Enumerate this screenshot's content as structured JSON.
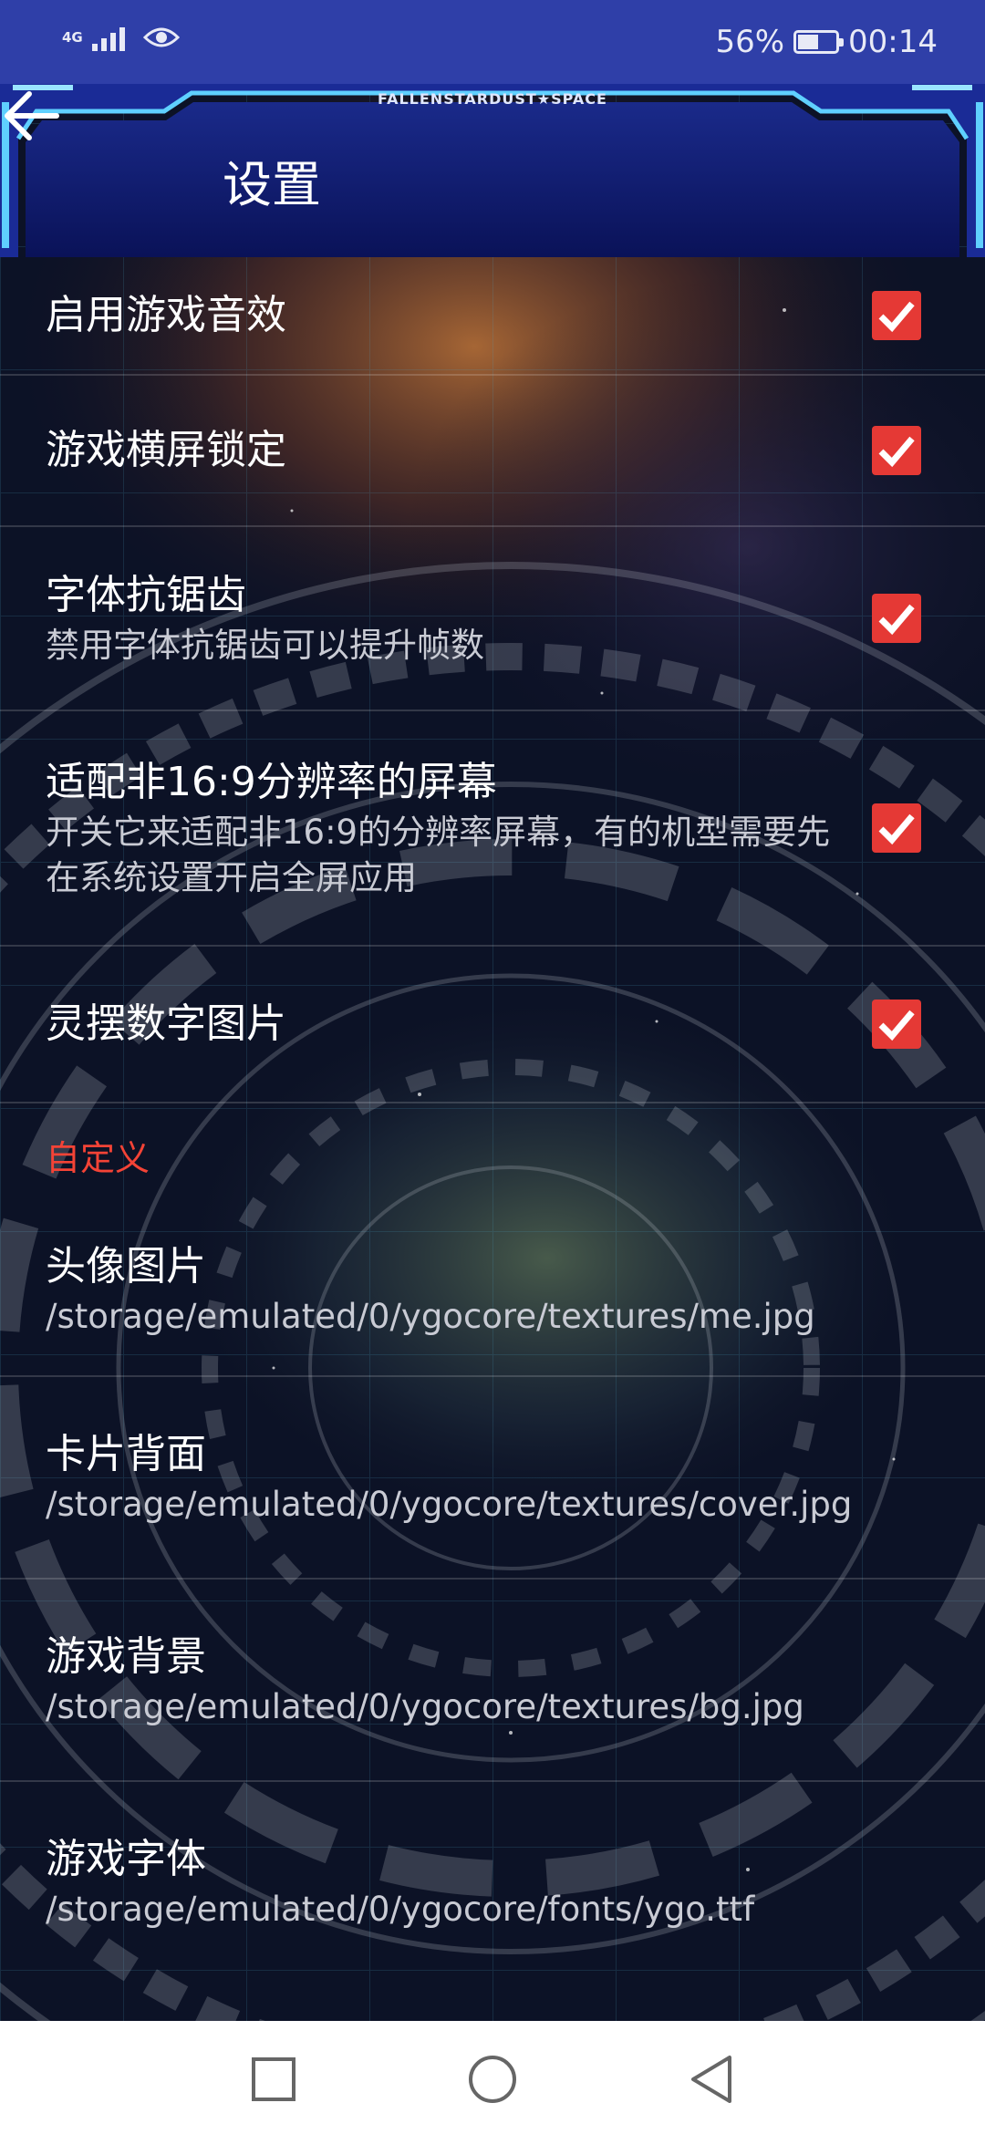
{
  "status_bar": {
    "network": "4G",
    "battery_percent": "56%",
    "battery_level": 0.56,
    "time": "00:14"
  },
  "app_bar": {
    "brand": "FALLENSTARDUST★SPACE",
    "title": "设置",
    "back_icon": "arrow-left-icon"
  },
  "settings": [
    {
      "title": "启用游戏音效",
      "subtitle": "",
      "checked": true
    },
    {
      "title": "游戏横屏锁定",
      "subtitle": "",
      "checked": true
    },
    {
      "title": "字体抗锯齿",
      "subtitle": "禁用字体抗锯齿可以提升帧数",
      "checked": true
    },
    {
      "title": "适配非16:9分辨率的屏幕",
      "subtitle": "开关它来适配非16:9的分辨率屏幕，有的机型需要先在系统设置开启全屏应用",
      "checked": true
    },
    {
      "title": "灵摆数字图片",
      "subtitle": "",
      "checked": true
    }
  ],
  "custom_section": {
    "header": "自定义",
    "items": [
      {
        "title": "头像图片",
        "path": "/storage/emulated/0/ygocore/textures/me.jpg"
      },
      {
        "title": "卡片背面",
        "path": "/storage/emulated/0/ygocore/textures/cover.jpg"
      },
      {
        "title": "游戏背景",
        "path": "/storage/emulated/0/ygocore/textures/bg.jpg"
      },
      {
        "title": "游戏字体",
        "path": "/storage/emulated/0/ygocore/fonts/ygo.ttf"
      }
    ]
  },
  "nav_bar": {
    "recents_icon": "square-icon",
    "home_icon": "circle-icon",
    "back_icon": "triangle-back-icon"
  },
  "colors": {
    "status_bar": "#2f3fa8",
    "accent_red": "#e53935",
    "section_header": "#f44336"
  }
}
